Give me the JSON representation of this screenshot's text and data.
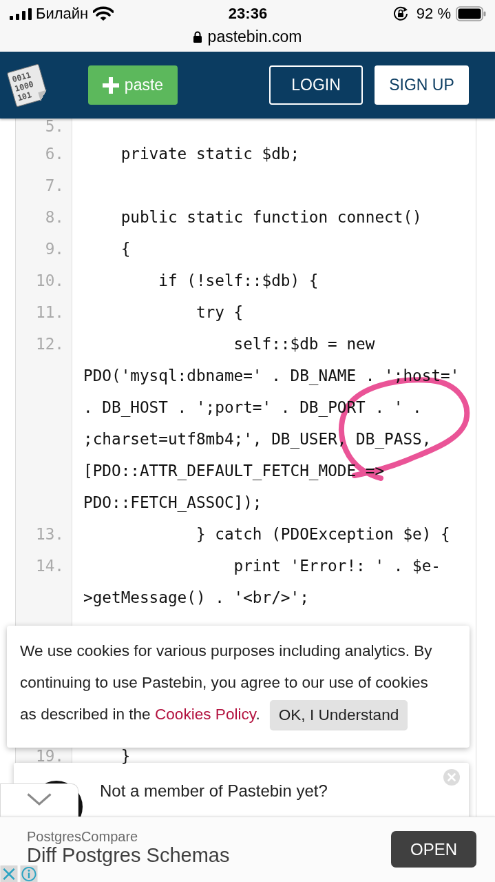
{
  "status_bar": {
    "carrier": "Билайн",
    "time": "23:36",
    "battery": "92 %",
    "url": "pastebin.com"
  },
  "header": {
    "logo_lines": [
      "0011",
      "1000",
      "101"
    ],
    "buttons": [
      {
        "label": "paste",
        "kind": "new-paste"
      },
      {
        "label": "LOGIN",
        "kind": "login"
      },
      {
        "label": "SIGN UP",
        "kind": "signup"
      }
    ]
  },
  "code": {
    "lines": [
      {
        "number": "5."
      },
      {
        "number": "6.",
        "rows": [
          "    private static $db;"
        ]
      },
      {
        "number": "7."
      },
      {
        "number": "8.",
        "rows": [
          "    public static function connect()"
        ]
      },
      {
        "number": "9.",
        "rows": [
          "    {"
        ]
      },
      {
        "number": "10.",
        "rows": [
          "        if (!self::$db) {"
        ]
      },
      {
        "number": "11.",
        "rows": [
          "            try {"
        ]
      },
      {
        "number": "12.",
        "rows": [
          "                self::$db = new",
          "PDO('mysql:dbname=' . DB_NAME . ';host='",
          ". DB_HOST . ';port=' . DB_PORT . ' .",
          ";charset=utf8mb4;', DB_USER, DB_PASS,",
          "[PDO::ATTR_DEFAULT_FETCH_MODE =>",
          "PDO::FETCH_ASSOC]);"
        ]
      },
      {
        "number": "13.",
        "rows": [
          "            } catch (PDOException $e) {"
        ]
      },
      {
        "number": "14.",
        "rows": [
          "                print 'Error!: ' . $e-",
          ">getMessage() . '<br/>';"
        ]
      }
    ],
    "after_banner": [
      {
        "number": "19.",
        "rows": [
          "    }"
        ]
      }
    ]
  },
  "annotations": [
    {
      "kind": "freehand-loop"
    }
  ],
  "cookie_notice": {
    "text": "We use cookies for various purposes including analytics. By continuing to use Pastebin, you agree to our use of cookies",
    "text_last_line": "as described in the ",
    "link": "Cookies Policy",
    "after_link": ".",
    "button": "OK, I Understand"
  },
  "member_prompt": {
    "text": "Not a member of Pastebin yet?"
  },
  "ad": {
    "advertiser": "PostgresCompare",
    "headline": "Diff Postgres Schemas",
    "button": "OPEN"
  }
}
